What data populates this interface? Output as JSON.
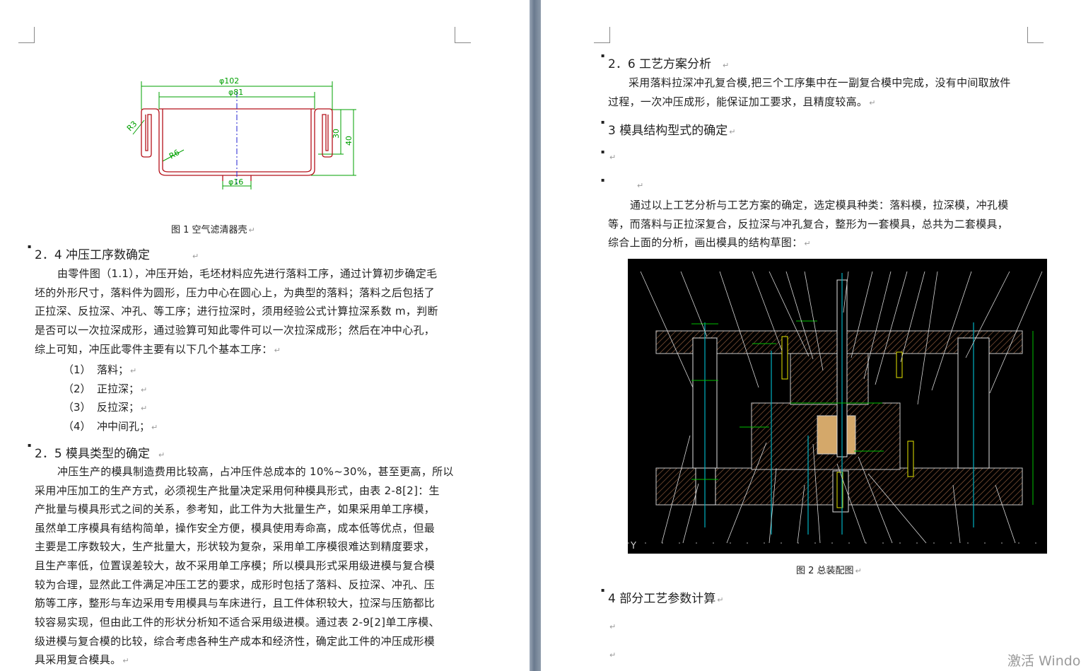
{
  "left": {
    "figure1": {
      "dim_outer": "φ102",
      "dim_inner": "φ81",
      "dim_bottom": "φ16",
      "dim_r3": "R3",
      "dim_r6": "R6",
      "dim_h30": "30",
      "dim_h40": "40",
      "caption": "图 1  空气滤清器壳"
    },
    "sec24": {
      "heading": "2．4 冲压工序数确定",
      "lines": [
        "由零件图（1.1），冲压开始，毛坯材料应先进行落料工序，通过计算初步确定毛",
        "坯的外形尺寸，落料件为圆形，压力中心在圆心上，为典型的落料；落料之后包括了",
        "正拉深、反拉深、冲孔、等工序；进行拉深时，须用经验公式计算拉深系数  m，判断",
        "是否可以一次拉深成形，通过验算可知此零件可以一次拉深成形；然后在冲中心孔，",
        "综上可知，冲压此零件主要有以下几个基本工序："
      ],
      "items": [
        {
          "num": "（1）",
          "text": "落料；"
        },
        {
          "num": "（2）",
          "text": "正拉深；"
        },
        {
          "num": "（3）",
          "text": "反拉深；"
        },
        {
          "num": "（4）",
          "text": "冲中间孔；"
        }
      ]
    },
    "sec25": {
      "heading": "2．5 模具类型的确定",
      "lines": [
        "冲压生产的模具制造费用比较高，占冲压件总成本的  10%~30%，甚至更高，所以",
        "采用冲压加工的生产方式，必须视生产批量决定采用何种模具形式，由表 2-8[2]：生",
        "产批量与模具形式之间的关系，参考知，此工件为大批量生产，如果采用单工序模，",
        "虽然单工序模具有结构简单，操作安全方便，模具使用寿命高，成本低等优点，但最",
        "主要是工序数较大，生产批量大，形状较为复杂，采用单工序模很难达到精度要求，",
        "且生产率低，位置误差较大，故不采用单工序模；所以模具形式采用级进模与复合模",
        "较为合理，显然此工件满足冲压工艺的要求，成形时包括了落料、反拉深、冲孔、压",
        "筋等工序，整形与车边采用专用模具与车床进行，且工件体积较大，拉深与压筋都比",
        "较容易实现，但由此工件的形状分析知不适合采用级进模。通过表 2-9[2]单工序模、",
        "级进模与复合模的比较，综合考虑各种生产成本和经济性，确定此工件的冲压成形模",
        "具采用复合模具。"
      ]
    }
  },
  "right": {
    "sec26": {
      "heading": "2．6 工艺方案分析",
      "lines": [
        "采用落料拉深冲孔复合模,把三个工序集中在一副复合模中完成，没有中间取放件",
        "过程，一次冲压成形，能保证加工要求，且精度较高。"
      ]
    },
    "sec3": {
      "heading": "3 模具结构型式的确定",
      "lines": [
        "通过以上工艺分析与工艺方案的确定，选定模具种类：落料模，拉深模，冲孔模",
        "等，而落料与正拉深复合，反拉深与冲孔复合，整形为一套模具，总共为二套模具，",
        "综合上面的分析，画出模具的结构草图："
      ]
    },
    "figure2": {
      "caption": "图 2  总装配图",
      "axis_mark": "Y"
    },
    "sec4": {
      "heading": "4   部分工艺参数计算"
    }
  },
  "watermark": "激活 Windo",
  "colors": {
    "page": "#ffffff",
    "background": "#7f8b99",
    "drawing_line": "#b5121b",
    "dim_line": "#00a000",
    "center_line": "#1f1fd1",
    "cad_bg": "#000000",
    "hatch": "#8b5a3c"
  }
}
